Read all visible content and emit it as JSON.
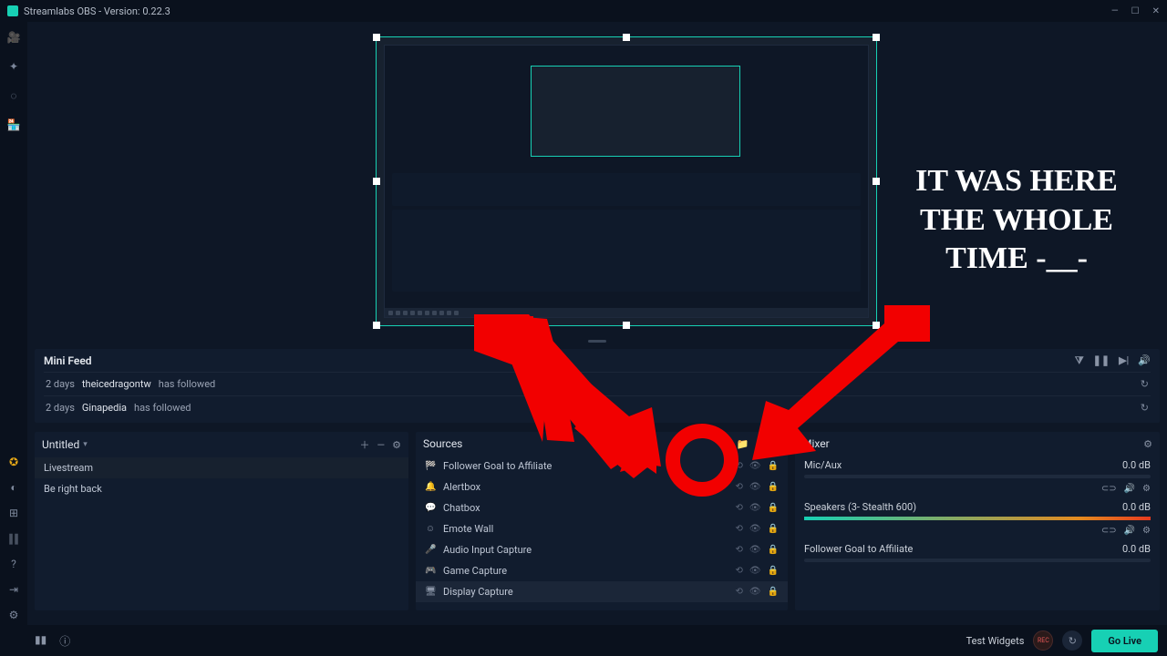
{
  "titlebar": {
    "title": "Streamlabs OBS - Version: 0.22.3"
  },
  "annotation": {
    "text": "IT WAS HERE THE WHOLE TIME -__-"
  },
  "feed": {
    "title": "Mini Feed",
    "rows": [
      {
        "age": "2 days",
        "name": "theicedragontw",
        "action": "has followed"
      },
      {
        "age": "2 days",
        "name": "Ginapedia",
        "action": "has followed"
      }
    ]
  },
  "scenes": {
    "title": "Untitled",
    "items": [
      "Livestream",
      "Be right back"
    ]
  },
  "sources": {
    "title": "Sources",
    "items": [
      {
        "icon": "🏁",
        "label": "Follower Goal to Affiliate"
      },
      {
        "icon": "🔔",
        "label": "Alertbox"
      },
      {
        "icon": "💬",
        "label": "Chatbox"
      },
      {
        "icon": "☺",
        "label": "Emote Wall"
      },
      {
        "icon": "🎤",
        "label": "Audio Input Capture"
      },
      {
        "icon": "🎮",
        "label": "Game Capture"
      },
      {
        "icon": "🖥",
        "label": "Display Capture"
      }
    ],
    "activeIndex": 6
  },
  "mixer": {
    "title": "Mixer",
    "channels": [
      {
        "label": "Mic/Aux",
        "db": "0.0 dB"
      },
      {
        "label": "Speakers (3- Stealth 600)",
        "db": "0.0 dB"
      },
      {
        "label": "Follower Goal to Affiliate",
        "db": "0.0 dB"
      }
    ]
  },
  "bottom": {
    "testWidgets": "Test Widgets",
    "rec": "REC",
    "goLive": "Go Live"
  }
}
